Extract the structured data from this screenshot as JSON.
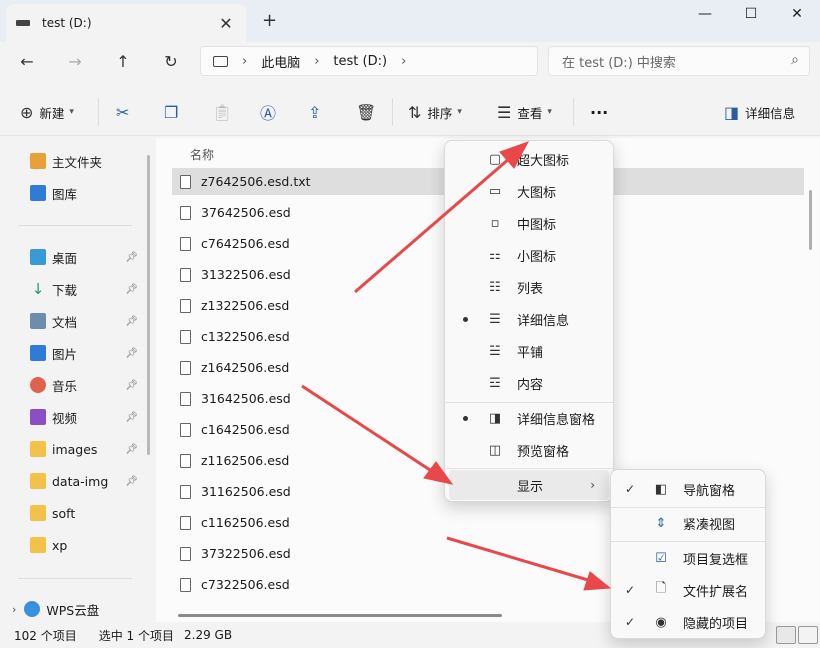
{
  "window": {
    "tab_title": "test (D:)",
    "close": "✕",
    "new_tab": "+",
    "minimize": "—",
    "maximize": "☐",
    "close_window": "✕"
  },
  "address": {
    "crumbs": [
      "此电脑",
      "test (D:)"
    ],
    "search_placeholder": "在 test (D:) 中搜索"
  },
  "toolbar": {
    "new": "新建",
    "sort": "排序",
    "view": "查看",
    "more": "···",
    "details": "详细信息"
  },
  "nav": {
    "home": "主文件夹",
    "gallery": "图库",
    "desktop": "桌面",
    "downloads": "下载",
    "documents": "文档",
    "pictures": "图片",
    "music": "音乐",
    "videos": "视频",
    "images": "images",
    "dataimg": "data-img",
    "soft": "soft",
    "xp": "xp",
    "wps": "WPS云盘"
  },
  "columns": {
    "name": "名称"
  },
  "files": [
    "z7642506.esd.txt",
    "37642506.esd",
    "c7642506.esd",
    "31322506.esd",
    "z1322506.esd",
    "c1322506.esd",
    "z1642506.esd",
    "31642506.esd",
    "c1642506.esd",
    "z1162506.esd",
    "31162506.esd",
    "c1162506.esd",
    "37322506.esd",
    "c7322506.esd"
  ],
  "status": {
    "count": "102 个项目",
    "selected": "选中 1 个项目",
    "size": "2.29 GB"
  },
  "view_menu": {
    "extra_large": "超大图标",
    "large": "大图标",
    "medium": "中图标",
    "small": "小图标",
    "list": "列表",
    "details": "详细信息",
    "tiles": "平铺",
    "content": "内容",
    "details_pane": "详细信息窗格",
    "preview_pane": "预览窗格",
    "show": "显示"
  },
  "show_menu": {
    "nav_pane": "导航窗格",
    "compact": "紧凑视图",
    "checkboxes": "项目复选框",
    "extensions": "文件扩展名",
    "hidden": "隐藏的项目"
  },
  "colors": {
    "accent": "#2a5d9f",
    "arrow": "#e8484a"
  }
}
